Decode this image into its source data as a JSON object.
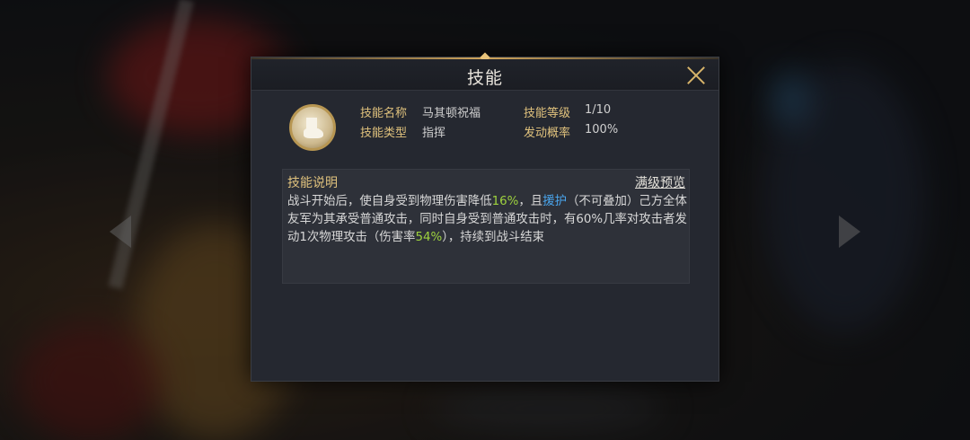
{
  "dialog": {
    "title": "技能",
    "skill": {
      "icon": "white-horse-emblem-icon",
      "name_label": "技能名称",
      "name_value": "马其顿祝福",
      "level_label": "技能等级",
      "level_value": "1/10",
      "type_label": "技能类型",
      "type_value": "指挥",
      "chance_label": "发动概率",
      "chance_value": "100%"
    },
    "description": {
      "label": "技能说明",
      "max_preview_link": "满级预览",
      "segments": {
        "s1": "战斗开始后，使自身受到物理伤害降低",
        "s2": "16%",
        "s3": "，且",
        "s4": "援护",
        "s5": "（不可叠加）己方全体友军为其承受普通攻击，同时自身受到普通攻击时，有60%几率对攻击者发动1次物理攻击（伤害率",
        "s6": "54%",
        "s7": "），持续到战斗结束"
      }
    }
  },
  "colors": {
    "accent_gold": "#e0c27d",
    "highlight_green": "#9ed23e",
    "keyword_blue": "#4aa6ee"
  }
}
